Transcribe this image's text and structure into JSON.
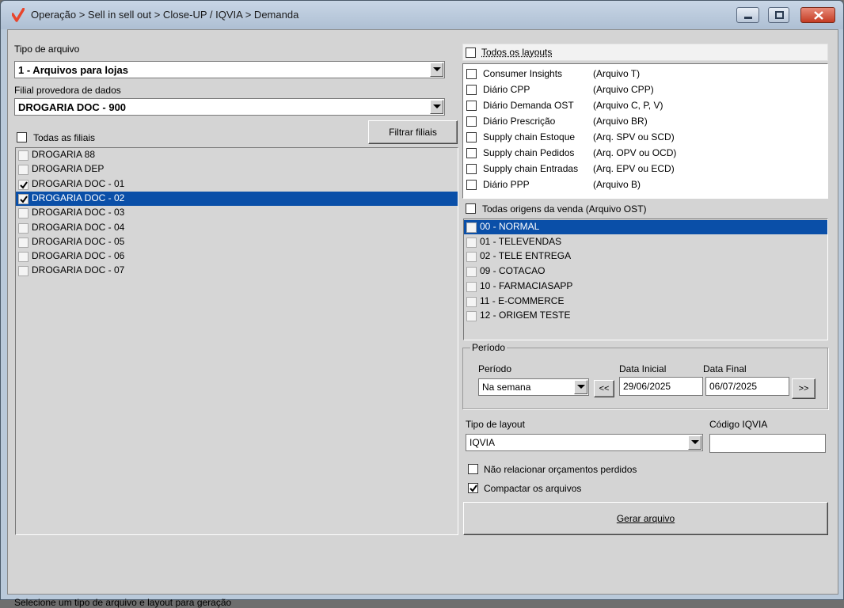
{
  "window": {
    "title": "Operação > Sell in sell out > Close-UP / IQVIA > Demanda",
    "accent": "#e8452c"
  },
  "left": {
    "tipo_arquivo_label": "Tipo de arquivo",
    "tipo_arquivo_value": "1 - Arquivos para lojas",
    "filial_label": "Filial provedora de dados",
    "filial_value": "DROGARIA DOC - 900",
    "todas_filiais_label": "Todas as filiais",
    "filtrar_button": "Filtrar filiais",
    "filiais": [
      {
        "name": "DROGARIA 88",
        "checked": false,
        "selected": false
      },
      {
        "name": "DROGARIA DEP",
        "checked": false,
        "selected": false
      },
      {
        "name": "DROGARIA DOC - 01",
        "checked": true,
        "selected": false
      },
      {
        "name": "DROGARIA DOC - 02",
        "checked": true,
        "selected": true
      },
      {
        "name": "DROGARIA DOC - 03",
        "checked": false,
        "selected": false
      },
      {
        "name": "DROGARIA DOC - 04",
        "checked": false,
        "selected": false
      },
      {
        "name": "DROGARIA DOC - 05",
        "checked": false,
        "selected": false
      },
      {
        "name": "DROGARIA DOC - 06",
        "checked": false,
        "selected": false
      },
      {
        "name": "DROGARIA DOC - 07",
        "checked": false,
        "selected": false
      }
    ]
  },
  "layouts": {
    "todos_label": "Todos os layouts",
    "items": [
      {
        "name": "Consumer Insights",
        "file": "(Arquivo T)"
      },
      {
        "name": "Diário CPP",
        "file": "(Arquivo CPP)"
      },
      {
        "name": "Diário Demanda OST",
        "file": "(Arquivo C, P, V)"
      },
      {
        "name": "Diário Prescrição",
        "file": "(Arquivo BR)"
      },
      {
        "name": "Supply chain Estoque",
        "file": "(Arq. SPV ou SCD)"
      },
      {
        "name": "Supply chain Pedidos",
        "file": "(Arq. OPV ou OCD)"
      },
      {
        "name": "Supply chain Entradas",
        "file": "(Arq. EPV ou ECD)"
      },
      {
        "name": "Diário PPP",
        "file": "(Arquivo B)"
      }
    ]
  },
  "origens": {
    "todas_label": "Todas origens da venda (Arquivo OST)",
    "items": [
      {
        "name": "00 - NORMAL",
        "selected": true
      },
      {
        "name": "01 - TELEVENDAS",
        "selected": false
      },
      {
        "name": "02 - TELE ENTREGA",
        "selected": false
      },
      {
        "name": "09 - COTACAO",
        "selected": false
      },
      {
        "name": "10 - FARMACIASAPP",
        "selected": false
      },
      {
        "name": "11 - E-COMMERCE",
        "selected": false
      },
      {
        "name": "12 - ORIGEM TESTE",
        "selected": false
      }
    ]
  },
  "periodo": {
    "group_title": "Período",
    "periodo_label": "Período",
    "periodo_value": "Na semana",
    "data_inicial_label": "Data Inicial",
    "data_inicial_value": "29/06/2025",
    "data_final_label": "Data Final",
    "data_final_value": "06/07/2025",
    "prev_button": "<<",
    "next_button": ">>"
  },
  "layout_options": {
    "tipo_layout_label": "Tipo de layout",
    "tipo_layout_value": "IQVIA",
    "codigo_label": "Código IQVIA",
    "codigo_value": "",
    "nao_relacionar_label": "Não relacionar orçamentos perdidos",
    "nao_relacionar_checked": false,
    "compactar_label": "Compactar os arquivos",
    "compactar_checked": true,
    "gerar_button": "Gerar arquivo"
  },
  "status": {
    "message": "Selecione um tipo de arquivo e layout para geração"
  }
}
